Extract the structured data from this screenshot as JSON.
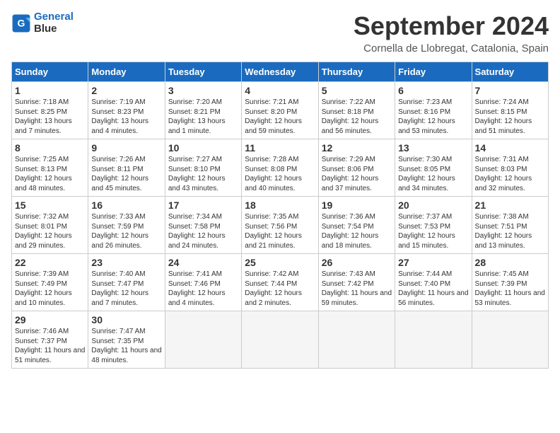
{
  "header": {
    "logo_line1": "General",
    "logo_line2": "Blue",
    "month": "September 2024",
    "location": "Cornella de Llobregat, Catalonia, Spain"
  },
  "weekdays": [
    "Sunday",
    "Monday",
    "Tuesday",
    "Wednesday",
    "Thursday",
    "Friday",
    "Saturday"
  ],
  "weeks": [
    [
      {
        "day": "1",
        "sunrise": "7:18 AM",
        "sunset": "8:25 PM",
        "daylight": "13 hours and 7 minutes."
      },
      {
        "day": "2",
        "sunrise": "7:19 AM",
        "sunset": "8:23 PM",
        "daylight": "13 hours and 4 minutes."
      },
      {
        "day": "3",
        "sunrise": "7:20 AM",
        "sunset": "8:21 PM",
        "daylight": "13 hours and 1 minute."
      },
      {
        "day": "4",
        "sunrise": "7:21 AM",
        "sunset": "8:20 PM",
        "daylight": "12 hours and 59 minutes."
      },
      {
        "day": "5",
        "sunrise": "7:22 AM",
        "sunset": "8:18 PM",
        "daylight": "12 hours and 56 minutes."
      },
      {
        "day": "6",
        "sunrise": "7:23 AM",
        "sunset": "8:16 PM",
        "daylight": "12 hours and 53 minutes."
      },
      {
        "day": "7",
        "sunrise": "7:24 AM",
        "sunset": "8:15 PM",
        "daylight": "12 hours and 51 minutes."
      }
    ],
    [
      {
        "day": "8",
        "sunrise": "7:25 AM",
        "sunset": "8:13 PM",
        "daylight": "12 hours and 48 minutes."
      },
      {
        "day": "9",
        "sunrise": "7:26 AM",
        "sunset": "8:11 PM",
        "daylight": "12 hours and 45 minutes."
      },
      {
        "day": "10",
        "sunrise": "7:27 AM",
        "sunset": "8:10 PM",
        "daylight": "12 hours and 43 minutes."
      },
      {
        "day": "11",
        "sunrise": "7:28 AM",
        "sunset": "8:08 PM",
        "daylight": "12 hours and 40 minutes."
      },
      {
        "day": "12",
        "sunrise": "7:29 AM",
        "sunset": "8:06 PM",
        "daylight": "12 hours and 37 minutes."
      },
      {
        "day": "13",
        "sunrise": "7:30 AM",
        "sunset": "8:05 PM",
        "daylight": "12 hours and 34 minutes."
      },
      {
        "day": "14",
        "sunrise": "7:31 AM",
        "sunset": "8:03 PM",
        "daylight": "12 hours and 32 minutes."
      }
    ],
    [
      {
        "day": "15",
        "sunrise": "7:32 AM",
        "sunset": "8:01 PM",
        "daylight": "12 hours and 29 minutes."
      },
      {
        "day": "16",
        "sunrise": "7:33 AM",
        "sunset": "7:59 PM",
        "daylight": "12 hours and 26 minutes."
      },
      {
        "day": "17",
        "sunrise": "7:34 AM",
        "sunset": "7:58 PM",
        "daylight": "12 hours and 24 minutes."
      },
      {
        "day": "18",
        "sunrise": "7:35 AM",
        "sunset": "7:56 PM",
        "daylight": "12 hours and 21 minutes."
      },
      {
        "day": "19",
        "sunrise": "7:36 AM",
        "sunset": "7:54 PM",
        "daylight": "12 hours and 18 minutes."
      },
      {
        "day": "20",
        "sunrise": "7:37 AM",
        "sunset": "7:53 PM",
        "daylight": "12 hours and 15 minutes."
      },
      {
        "day": "21",
        "sunrise": "7:38 AM",
        "sunset": "7:51 PM",
        "daylight": "12 hours and 13 minutes."
      }
    ],
    [
      {
        "day": "22",
        "sunrise": "7:39 AM",
        "sunset": "7:49 PM",
        "daylight": "12 hours and 10 minutes."
      },
      {
        "day": "23",
        "sunrise": "7:40 AM",
        "sunset": "7:47 PM",
        "daylight": "12 hours and 7 minutes."
      },
      {
        "day": "24",
        "sunrise": "7:41 AM",
        "sunset": "7:46 PM",
        "daylight": "12 hours and 4 minutes."
      },
      {
        "day": "25",
        "sunrise": "7:42 AM",
        "sunset": "7:44 PM",
        "daylight": "12 hours and 2 minutes."
      },
      {
        "day": "26",
        "sunrise": "7:43 AM",
        "sunset": "7:42 PM",
        "daylight": "11 hours and 59 minutes."
      },
      {
        "day": "27",
        "sunrise": "7:44 AM",
        "sunset": "7:40 PM",
        "daylight": "11 hours and 56 minutes."
      },
      {
        "day": "28",
        "sunrise": "7:45 AM",
        "sunset": "7:39 PM",
        "daylight": "11 hours and 53 minutes."
      }
    ],
    [
      {
        "day": "29",
        "sunrise": "7:46 AM",
        "sunset": "7:37 PM",
        "daylight": "11 hours and 51 minutes."
      },
      {
        "day": "30",
        "sunrise": "7:47 AM",
        "sunset": "7:35 PM",
        "daylight": "11 hours and 48 minutes."
      },
      null,
      null,
      null,
      null,
      null
    ]
  ]
}
